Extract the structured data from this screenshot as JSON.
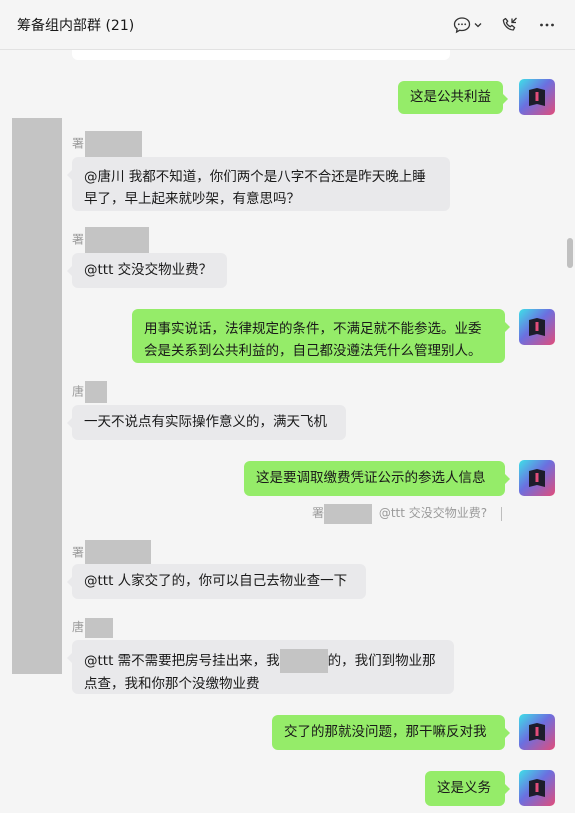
{
  "header": {
    "title": "筹备组内部群 (21)",
    "icons": [
      "chat-icon",
      "chevron-down-icon",
      "phone-icon",
      "more-icon"
    ]
  },
  "messages": [
    {
      "side": "right",
      "text": "这是公共利益"
    },
    {
      "side": "left",
      "sender": "署",
      "text": "@唐川 我都不知道，你们两个是八字不合还是昨天晚上睡早了，早上起来就吵架，有意思吗？"
    },
    {
      "side": "left",
      "sender": "署",
      "text": "@ttt 交没交物业费？"
    },
    {
      "side": "right",
      "text": "用事实说话，法律规定的条件，不满足就不能参选。业委会是关系到公共利益的，自己都没遵法凭什么管理别人。"
    },
    {
      "side": "left",
      "sender": "唐",
      "text": "一天不说点有实际操作意义的，满天飞机"
    },
    {
      "side": "right",
      "text": "这是要调取缴费凭证公示的参选人信息",
      "quote_prefix": "署",
      "quote_text": "@ttt 交没交物业费?"
    },
    {
      "side": "left",
      "sender": "署",
      "text": "@ttt 人家交了的，你可以自己去物业查一下"
    },
    {
      "side": "left",
      "sender": "唐",
      "text_a": "@ttt 需不需要把房号挂出来，我",
      "text_b": "的，我们到物业那点查，我和你那个没缴物业费"
    },
    {
      "side": "right",
      "text": "交了的那就没问题，那干嘛反对我"
    },
    {
      "side": "right",
      "text": "这是义务"
    }
  ]
}
